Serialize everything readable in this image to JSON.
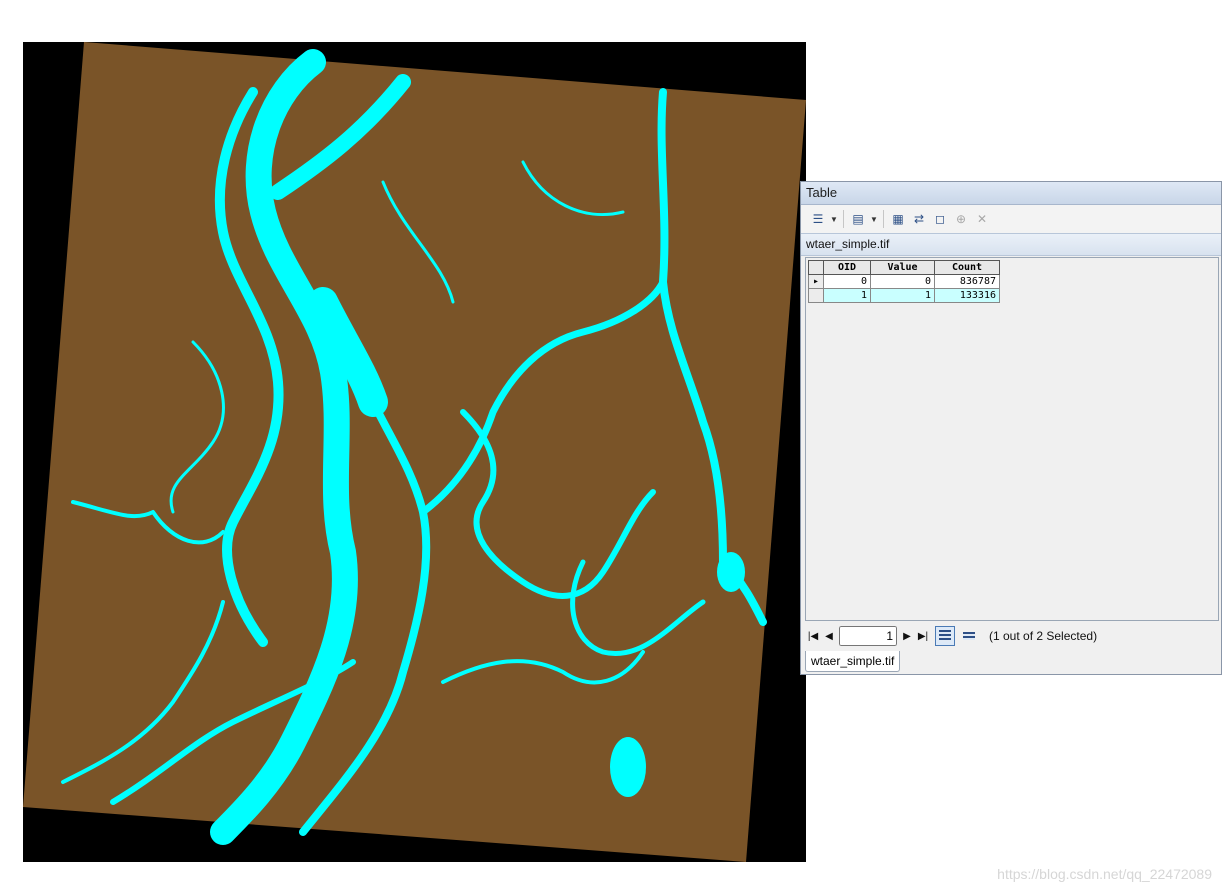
{
  "window": {
    "title": "Table"
  },
  "toolbar": {
    "icons": [
      "table-options-icon",
      "related-tables-icon",
      "select-by-attributes-icon",
      "switch-selection-icon",
      "clear-selection-icon",
      "zoom-selected-icon",
      "delete-selected-icon"
    ]
  },
  "layer": {
    "tab_name": "wtaer_simple.tif"
  },
  "table": {
    "columns": [
      "OID",
      "Value",
      "Count"
    ],
    "rows": [
      {
        "oid": "0",
        "value": "0",
        "count": "836787"
      },
      {
        "oid": "1",
        "value": "1",
        "count": "133316"
      }
    ]
  },
  "navigator": {
    "current_record": "1",
    "status": "(1 out of 2 Selected)"
  },
  "watermark": "https://blog.csdn.net/qq_22472089",
  "colors": {
    "land": "#7a5428",
    "water": "#00ffff",
    "nodata": "#000000",
    "selection": "#c9ffff"
  }
}
